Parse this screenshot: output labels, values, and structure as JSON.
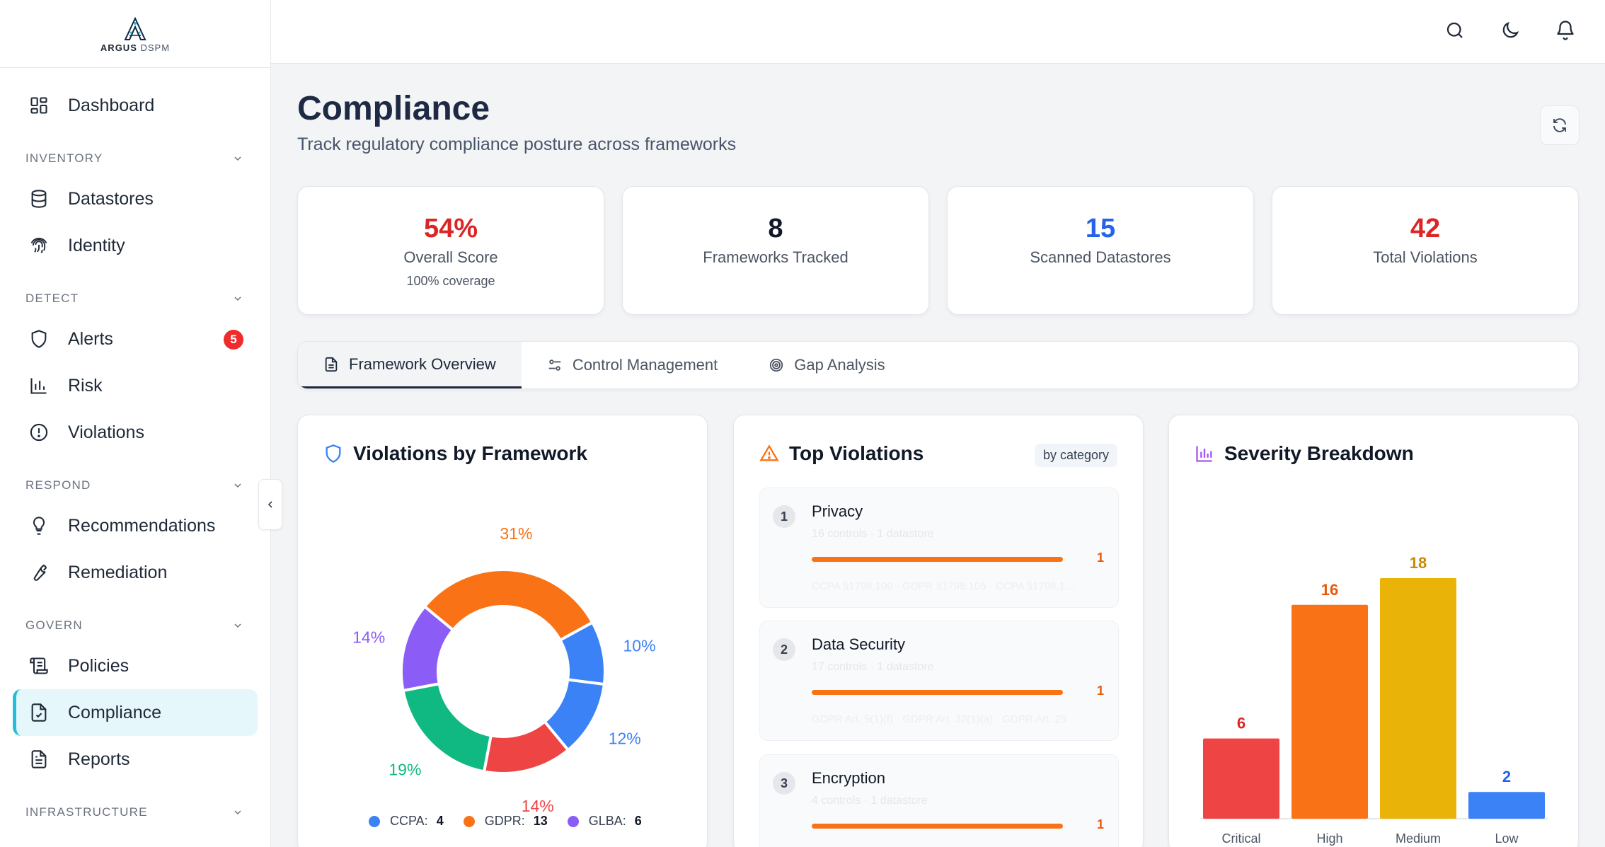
{
  "brand": {
    "name": "ARGUS",
    "suffix": "DSPM"
  },
  "sidebar": {
    "dashboard": "Dashboard",
    "sections": {
      "inventory": "INVENTORY",
      "detect": "DETECT",
      "respond": "RESPOND",
      "govern": "GOVERN",
      "infrastructure": "INFRASTRUCTURE"
    },
    "items": {
      "datastores": "Datastores",
      "identity": "Identity",
      "alerts": "Alerts",
      "alerts_badge": "5",
      "risk": "Risk",
      "violations": "Violations",
      "recommendations": "Recommendations",
      "remediation": "Remediation",
      "policies": "Policies",
      "compliance": "Compliance",
      "reports": "Reports"
    }
  },
  "page": {
    "title": "Compliance",
    "subtitle": "Track regulatory compliance posture across frameworks"
  },
  "stats": [
    {
      "value": "54%",
      "label": "Overall Score",
      "sub": "100% coverage",
      "color": "#dc2626"
    },
    {
      "value": "8",
      "label": "Frameworks Tracked",
      "color": "#111827"
    },
    {
      "value": "15",
      "label": "Scanned Datastores",
      "color": "#2563eb"
    },
    {
      "value": "42",
      "label": "Total Violations",
      "color": "#dc2626"
    }
  ],
  "tabs": [
    "Framework Overview",
    "Control Management",
    "Gap Analysis"
  ],
  "violations_by_framework": {
    "title": "Violations by Framework",
    "legend": [
      {
        "name": "CCPA:",
        "count": "4",
        "color": "#3b82f6"
      },
      {
        "name": "GDPR:",
        "count": "13",
        "color": "#f97316"
      },
      {
        "name": "GLBA:",
        "count": "6",
        "color": "#8b5cf6"
      }
    ]
  },
  "top_violations": {
    "title": "Top Violations",
    "chip": "by category",
    "items": [
      {
        "rank": "1",
        "name": "Privacy",
        "meta": "16 controls · 1 datastore",
        "count": "1",
        "footer": "CCPA §1798.100 · GDPR §1798.105 · CCPA §1798.1..."
      },
      {
        "rank": "2",
        "name": "Data Security",
        "meta": "17 controls · 1 datastore",
        "count": "1",
        "footer": "GDPR Art. 5(1)(f) · GDPR Art. 32(1)(a) · GDPR Art. 25"
      },
      {
        "rank": "3",
        "name": "Encryption",
        "meta": "4 controls · 1 datastore",
        "count": "1",
        "footer": ""
      }
    ]
  },
  "severity": {
    "title": "Severity Breakdown"
  },
  "chart_data": [
    {
      "type": "pie",
      "variant": "donut",
      "title": "Violations by Framework",
      "slices": [
        {
          "label": "31%",
          "value": 31,
          "color": "#f97316"
        },
        {
          "label": "10%",
          "value": 10,
          "color": "#3b82f6"
        },
        {
          "label": "12%",
          "value": 12,
          "color": "#3b82f6"
        },
        {
          "label": "14%",
          "value": 14,
          "color": "#ef4444"
        },
        {
          "label": "19%",
          "value": 19,
          "color": "#10b981"
        },
        {
          "label": "14%",
          "value": 14,
          "color": "#8b5cf6"
        }
      ]
    },
    {
      "type": "bar",
      "title": "Severity Breakdown",
      "categories": [
        "Critical",
        "High",
        "Medium",
        "Low"
      ],
      "values": [
        6,
        16,
        18,
        2
      ],
      "colors": [
        "#ef4444",
        "#f97316",
        "#eab308",
        "#3b82f6"
      ],
      "label_colors": [
        "#dc2626",
        "#ea580c",
        "#ca8a04",
        "#2563eb"
      ],
      "ylim": [
        0,
        18
      ]
    }
  ]
}
